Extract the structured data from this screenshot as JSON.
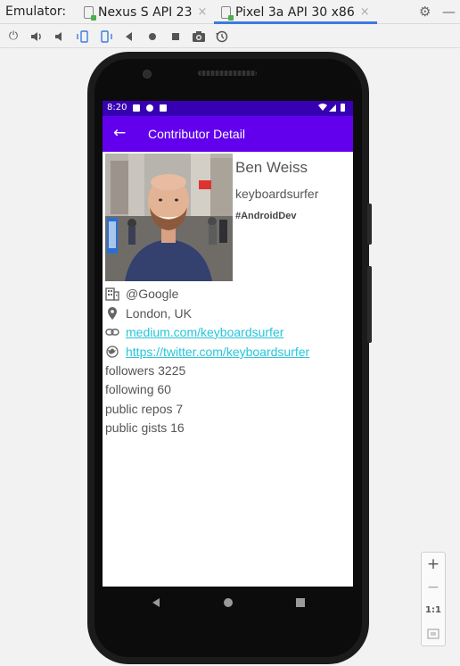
{
  "topbar": {
    "label": "Emulator:",
    "tabs": [
      {
        "label": "Nexus S API 23",
        "close": "×"
      },
      {
        "label": "Pixel 3a API 30 x86",
        "close": "×"
      }
    ]
  },
  "device": {
    "status": {
      "time": "8:20"
    },
    "appbar": {
      "title": "Contributor Detail",
      "back": "←"
    },
    "profile": {
      "name": "Ben Weiss",
      "login": "keyboardsurfer",
      "bio": "#AndroidDev",
      "company": "@Google",
      "location": "London, UK",
      "blog": "medium.com/keyboardsurfer",
      "twitter": "https://twitter.com/keyboardsurfer"
    },
    "stats": [
      {
        "text": "followers  3225"
      },
      {
        "text": "following  60"
      },
      {
        "text": "public repos  7"
      },
      {
        "text": "public gists  16"
      }
    ]
  },
  "zoom": {
    "plus": "+",
    "minus": "−",
    "one": "1:1"
  }
}
